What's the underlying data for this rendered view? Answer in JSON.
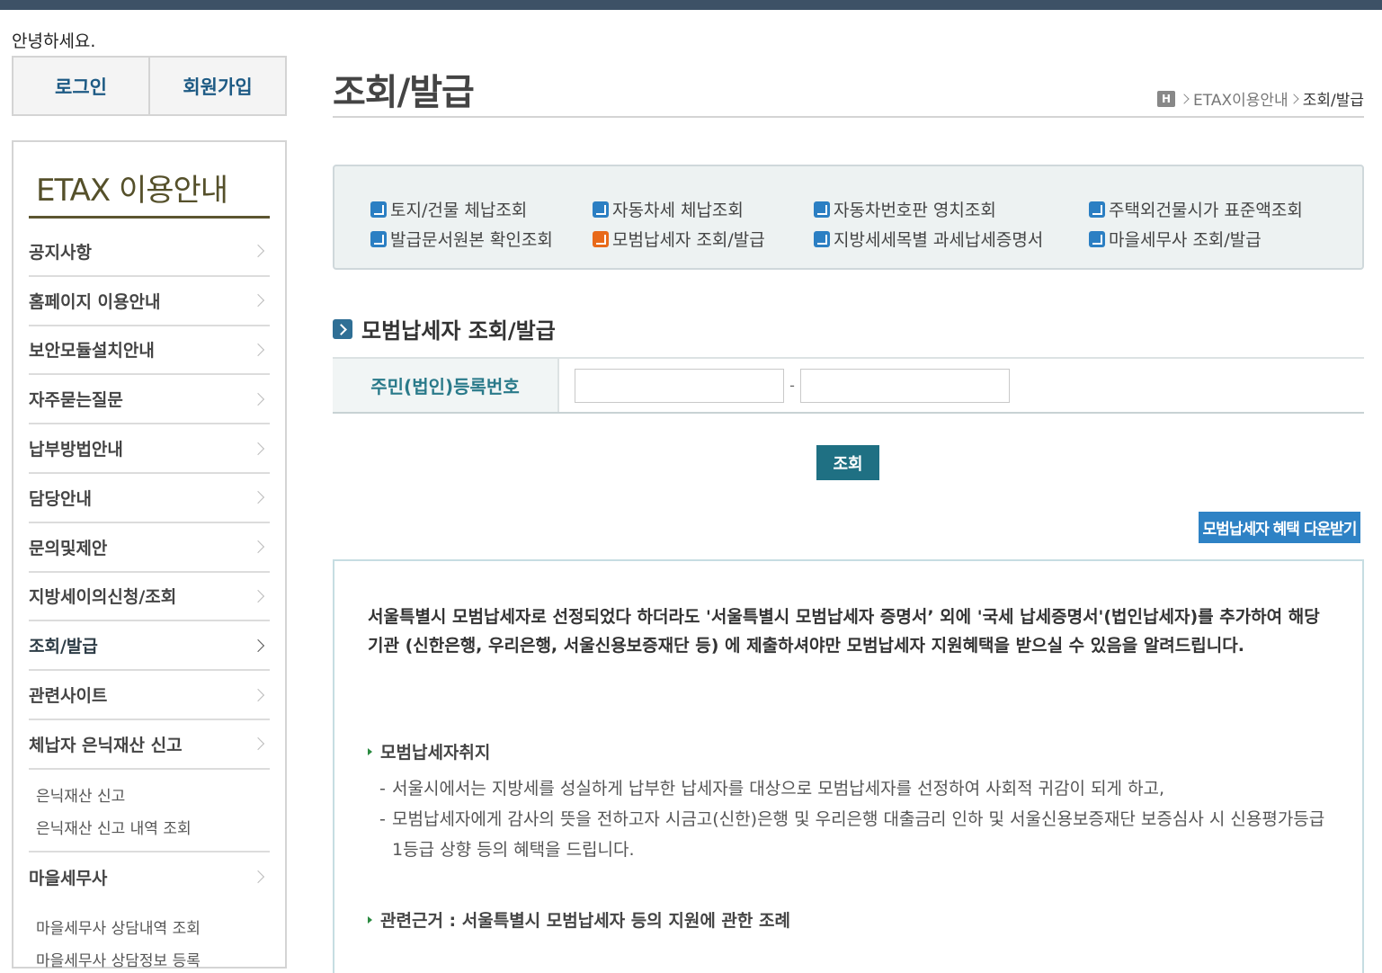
{
  "greeting": "안녕하세요.",
  "auth": {
    "login": "로그인",
    "signup": "회원가입"
  },
  "sidebar": {
    "title": "ETAX 이용안내",
    "items": [
      {
        "label": "공지사항"
      },
      {
        "label": "홈페이지 이용안내"
      },
      {
        "label": "보안모듈설치안내"
      },
      {
        "label": "자주묻는질문"
      },
      {
        "label": "납부방법안내"
      },
      {
        "label": "담당안내"
      },
      {
        "label": "문의및제안"
      },
      {
        "label": "지방세이의신청/조회"
      },
      {
        "label": "조회/발급"
      },
      {
        "label": "관련사이트"
      },
      {
        "label": "체납자 은닉재산 신고"
      },
      {
        "label": "마을세무사"
      }
    ],
    "hidden_asset_sub": [
      "은닉재산 신고",
      "은닉재산 신고 내역 조회"
    ],
    "village_tax_sub": [
      "마을세무사 상담내역 조회",
      "마을세무사 상담정보 등록"
    ]
  },
  "page": {
    "title": "조회/발급",
    "breadcrumb": {
      "home": "H",
      "level1": "ETAX이용안내",
      "current": "조회/발급"
    }
  },
  "quick_links": [
    "토지/건물 체납조회",
    "자동차세 체납조회",
    "자동차번호판 영치조회",
    "주택외건물시가 표준액조회",
    "발급문서원본 확인조회",
    "모범납세자 조회/발급",
    "지방세세목별 과세납세증명서",
    "마을세무사 조회/발급"
  ],
  "section": {
    "title": "모범납세자 조회/발급",
    "form_label": "주민(법인)등록번호",
    "dash": "-",
    "search_button": "조회",
    "download_button": "모범납세자 혜택 다운받기"
  },
  "info": {
    "notice": "서울특별시 모범납세자로 선정되었다 하더라도 '서울특별시 모범납세자 증명서’ 외에 '국세 납세증명서'(법인납세자)를 추가하여 해당 기관 (신한은행, 우리은행, 서울신용보증재단 등) 에 제출하셔야만 모범납세자 지원혜택을 받으실 수 있음을 알려드립니다.",
    "purpose_head": "모범납세자취지",
    "purpose_lines": [
      "서울시에서는 지방세를 성실하게 납부한 납세자를 대상으로 모범납세자를 선정하여 사회적 귀감이 되게 하고,",
      "모범납세자에게 감사의 뜻을 전하고자 시금고(신한)은행 및 우리은행 대출금리 인하 및 서울신용보증재단 보증심사 시 신용평가등급 1등급 상향 등의 혜택을 드립니다."
    ],
    "bullet_dash": "-",
    "legal_head": "관련근거 : 서울특별시 모범납세자 등의 지원에 관한 조례"
  },
  "colors": {
    "topbar": "#3d5166",
    "accent_teal": "#1f7083",
    "link_blue": "#2b7fc3",
    "active_orange": "#e86a1a",
    "download_blue": "#2e82c5"
  }
}
